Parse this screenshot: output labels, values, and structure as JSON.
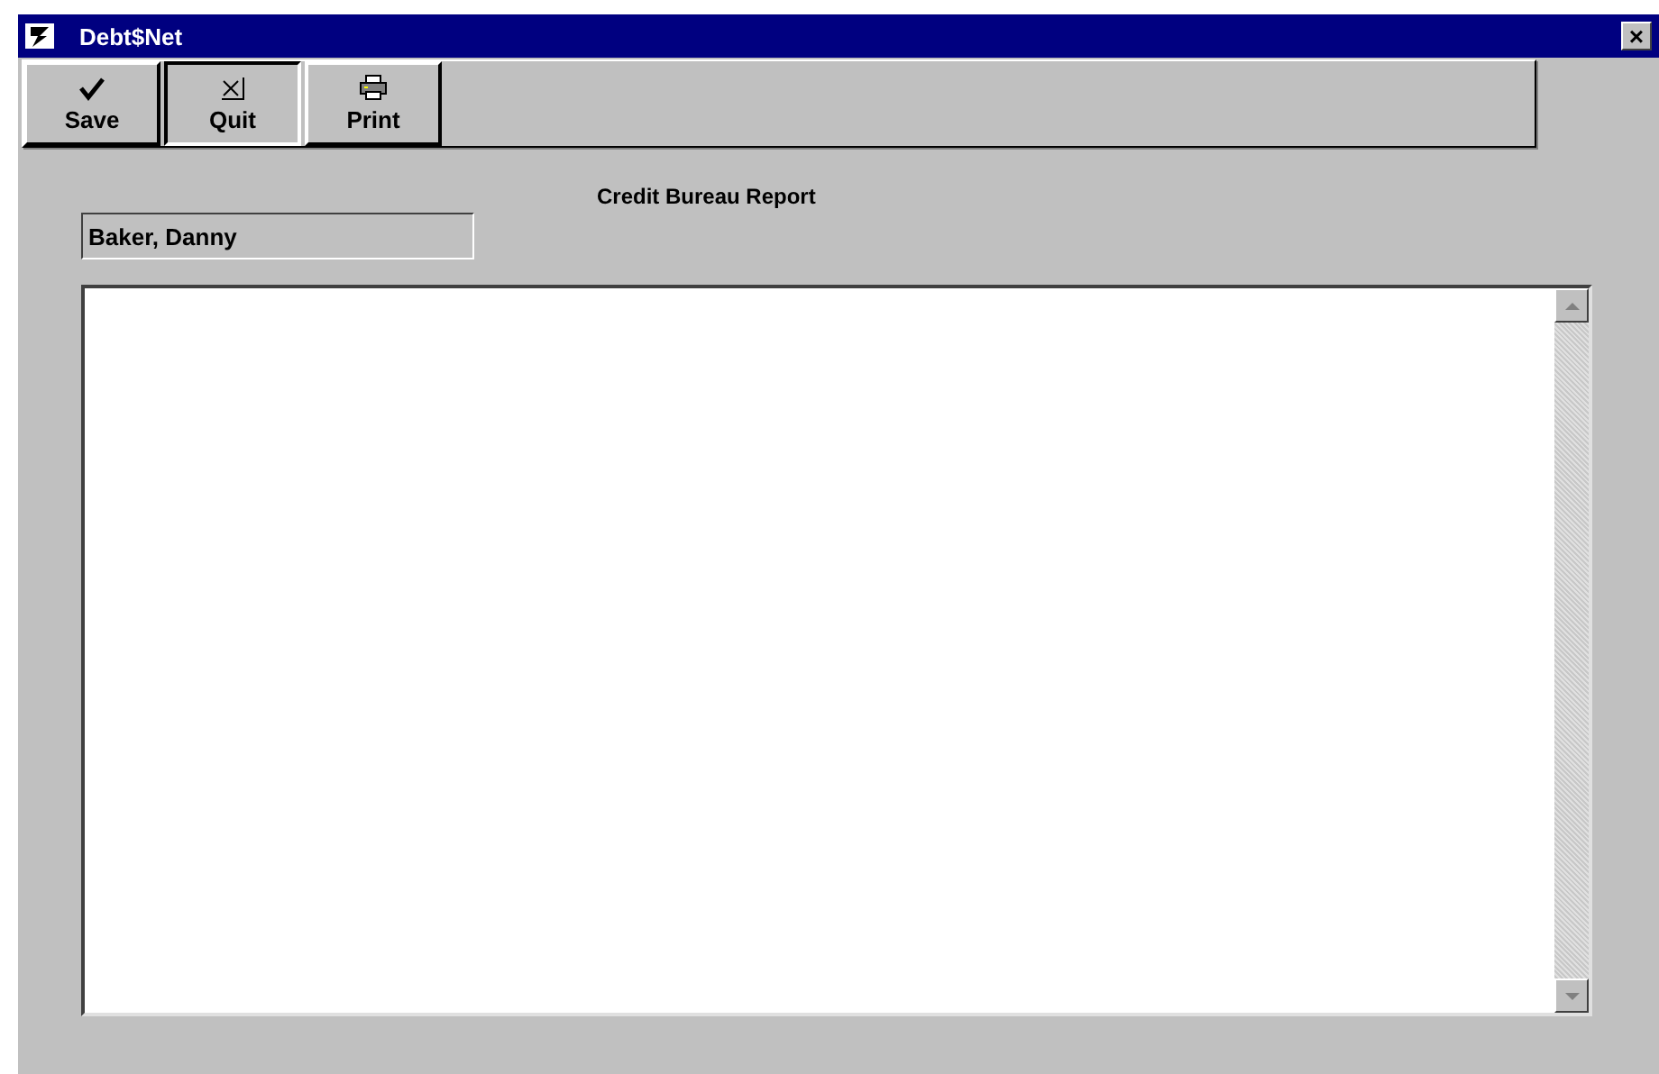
{
  "window": {
    "title": "Debt$Net",
    "close": "×"
  },
  "toolbar": {
    "buttons": [
      {
        "label": "Save",
        "kind": "save",
        "pressed": false
      },
      {
        "label": "Quit",
        "kind": "quit",
        "pressed": true
      },
      {
        "label": "Print",
        "kind": "print",
        "pressed": false
      }
    ]
  },
  "report": {
    "title": "Credit Bureau Report",
    "name": "Baker, Danny"
  }
}
